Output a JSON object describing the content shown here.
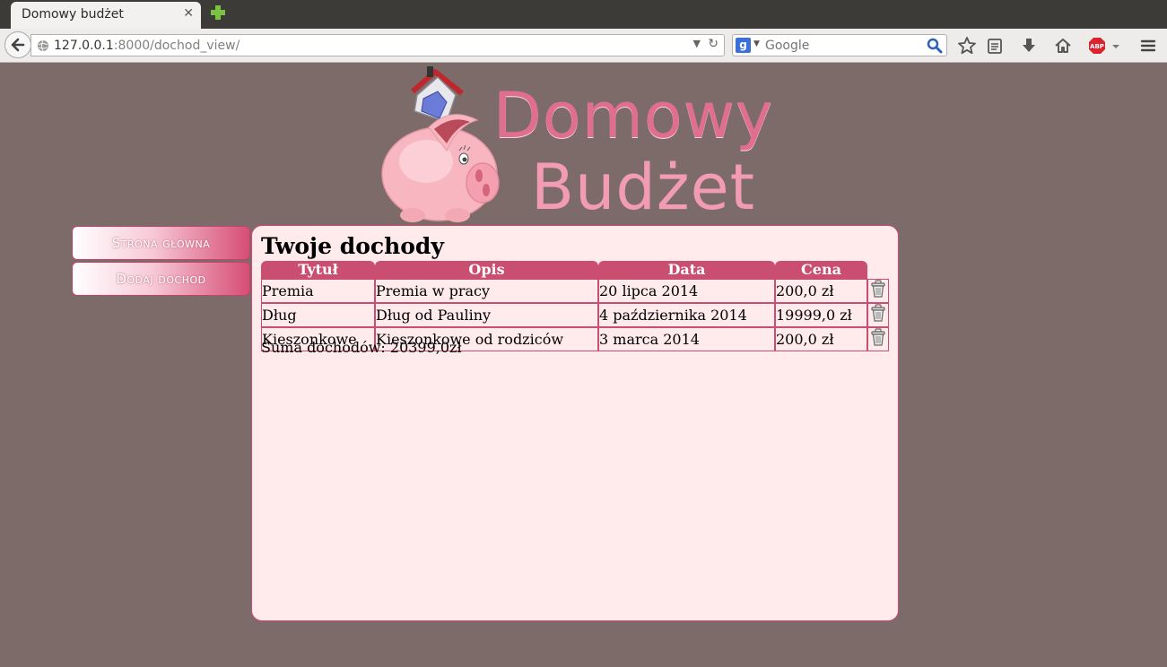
{
  "browser": {
    "tab_title": "Domowy budżet",
    "tab_close": "✕",
    "url_host": "127.0.0.1",
    "url_rest": ":8000/dochod_view/",
    "search_placeholder": "Google"
  },
  "logo": {
    "line1": "Domowy",
    "line2": "Budżet"
  },
  "menu": {
    "home_label": "Strona główna",
    "add_label": "Dodaj dochod"
  },
  "content": {
    "heading": "Twoje dochody",
    "columns": [
      "Tytuł",
      "Opis",
      "Data",
      "Cena"
    ],
    "rows": [
      {
        "title": "Premia",
        "description": "Premia w pracy",
        "date": "20 lipca 2014",
        "price": "200,0 zł"
      },
      {
        "title": "Dług",
        "description": "Dług od Pauliny",
        "date": "4 października 2014",
        "price": "19999,0 zł"
      },
      {
        "title": "Kieszonkowe",
        "description": "Kieszonkowe od rodziców",
        "date": "3 marca 2014",
        "price": "200,0 zł"
      }
    ],
    "total": "Suma dochodów: 20399,0zł"
  },
  "colors": {
    "page_bg": "#7d6b6a",
    "accent": "#c94e70",
    "panel_bg": "#ffeaec"
  }
}
